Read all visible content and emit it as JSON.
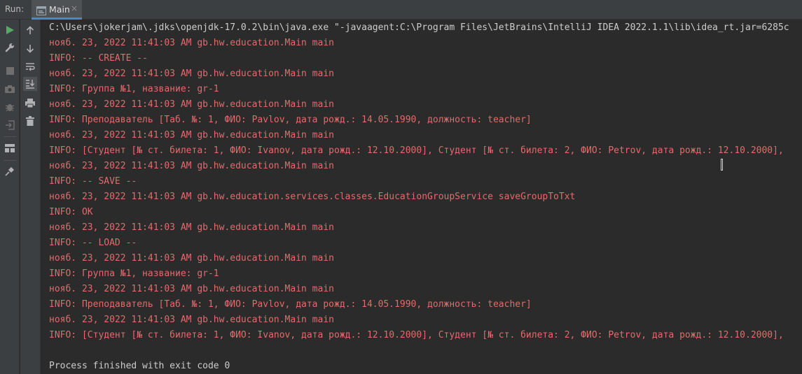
{
  "toolwindow": {
    "run_label": "Run:",
    "tab_label": "Main",
    "tab_close": "×"
  },
  "left_toolbar": [
    "run-icon",
    "wrench-icon",
    "stop-icon",
    "camera-icon",
    "bug-icon",
    "login-icon",
    "layout-icon",
    "pin-icon"
  ],
  "right_toolbar": [
    "arrow-up-icon",
    "arrow-down-icon",
    "soft-wrap-icon",
    "scroll-to-end-icon",
    "print-icon",
    "trash-icon"
  ],
  "console": {
    "command": "C:\\Users\\jokerjam\\.jdks\\openjdk-17.0.2\\bin\\java.exe \"-javaagent:C:\\Program Files\\JetBrains\\IntelliJ IDEA 2022.1.1\\lib\\idea_rt.jar=6285c",
    "lines": [
      "нояб. 23, 2022 11:41:03 AM gb.hw.education.Main main",
      "INFO: -- CREATE --",
      "нояб. 23, 2022 11:41:03 AM gb.hw.education.Main main",
      "INFO: Группа №1, название: gr-1",
      "нояб. 23, 2022 11:41:03 AM gb.hw.education.Main main",
      "INFO: Преподаватель [Таб. №: 1, ФИО: Pavlov, дата рожд.: 14.05.1990, должность: teacher]",
      "нояб. 23, 2022 11:41:03 AM gb.hw.education.Main main",
      "INFO: [Студент [№ ст. билета: 1, ФИО: Ivanov, дата рожд.: 12.10.2000], Студент [№ ст. билета: 2, ФИО: Petrov, дата рожд.: 12.10.2000],",
      "нояб. 23, 2022 11:41:03 AM gb.hw.education.Main main",
      "INFO: -- SAVE --",
      "нояб. 23, 2022 11:41:03 AM gb.hw.education.services.classes.EducationGroupService saveGroupToTxt",
      "INFO: OK",
      "нояб. 23, 2022 11:41:03 AM gb.hw.education.Main main",
      "INFO: -- LOAD --",
      "нояб. 23, 2022 11:41:03 AM gb.hw.education.Main main",
      "INFO: Группа №1, название: gr-1",
      "нояб. 23, 2022 11:41:03 AM gb.hw.education.Main main",
      "INFO: Преподаватель [Таб. №: 1, ФИО: Pavlov, дата рожд.: 14.05.1990, должность: teacher]",
      "нояб. 23, 2022 11:41:03 AM gb.hw.education.Main main",
      "INFO: [Студент [№ ст. билета: 1, ФИО: Ivanov, дата рожд.: 12.10.2000], Студент [№ ст. билета: 2, ФИО: Petrov, дата рожд.: 12.10.2000],"
    ],
    "exit_message": "Process finished with exit code 0"
  },
  "colors": {
    "stderr_text": "#e06c6c",
    "stdout_text": "#cccccc",
    "background": "#2b2b2b",
    "tab_underline": "#4a88c7",
    "run_green": "#59a869"
  }
}
